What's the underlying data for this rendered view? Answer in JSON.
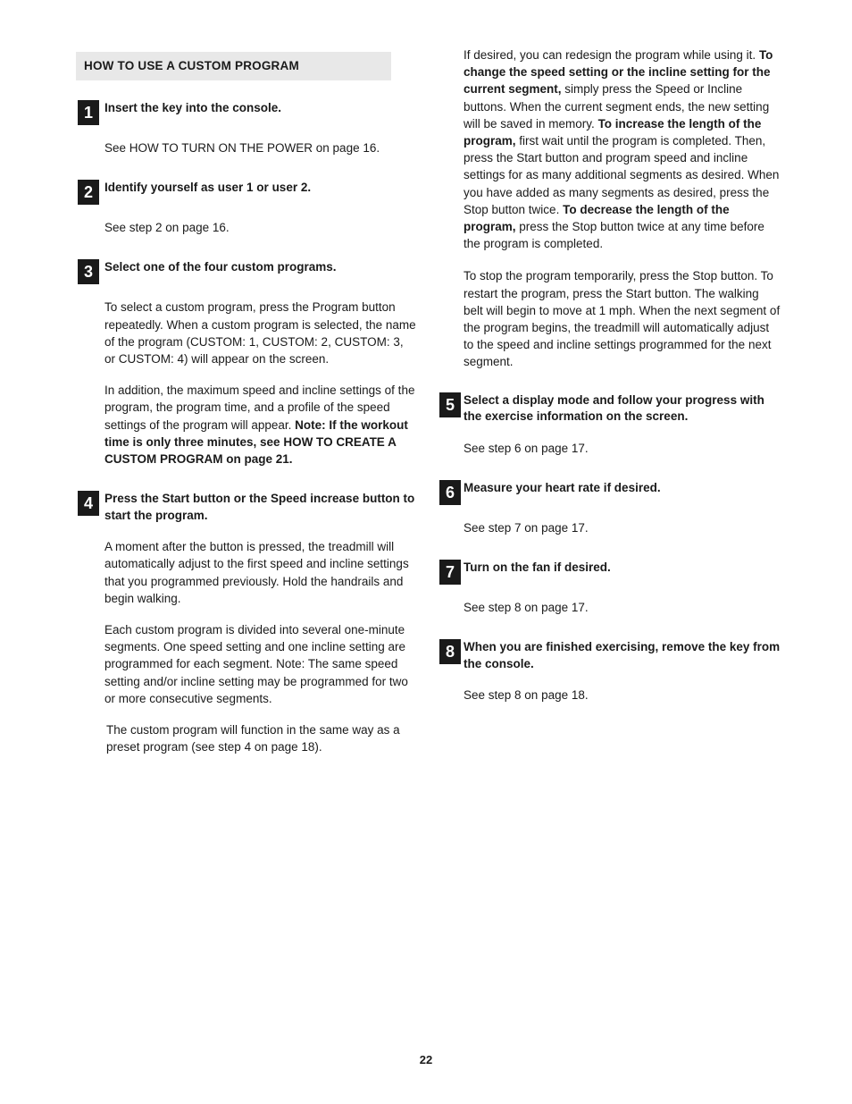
{
  "document": {
    "page_number": "22",
    "banner_title": "HOW TO USE A CUSTOM PROGRAM"
  },
  "left_column": {
    "steps": [
      {
        "number": "1",
        "title": "Insert the key into the console.",
        "body": "See HOW TO TURN ON THE POWER on page 16."
      },
      {
        "number": "2",
        "title": "Identify yourself as user 1 or user 2.",
        "body": "See step 2 on page 16."
      },
      {
        "number": "3",
        "title": "Select one of the four custom programs.",
        "body": "To select a custom program, press the Program button repeatedly. When a custom program is selected, the name of the program (CUSTOM: 1, CUSTOM: 2, CUSTOM: 3, or CUSTOM: 4) will appear on the screen.",
        "body2_plain": "In addition, the maximum speed and incline settings of the program, the program time, and a profile of the speed settings of the program will appear. ",
        "body2_bold": "Note: If the workout time is only three minutes, see HOW TO CREATE A CUSTOM PROGRAM on page 21."
      },
      {
        "number": "4",
        "title": "Press the Start button or the Speed increase button to start the program.",
        "body": "A moment after the button is pressed, the treadmill will automatically adjust to the first speed and incline settings that you programmed previously. Hold the handrails and begin walking.",
        "body2": "Each custom program is divided into several one-minute segments. One speed setting and one incline setting are programmed for each segment. Note: The same speed setting and/or incline setting may be programmed for two or more consecutive segments.",
        "body3": "The custom program will function in the same way as a preset program (see step 4 on page 18)."
      }
    ]
  },
  "right_column": {
    "lead_paragraph": {
      "part1": "If desired, you can redesign the program while using it. ",
      "bold1": "To change the speed setting or the incline setting for the current segment,",
      "part2": " simply press the Speed or Incline buttons. When the current segment ends, the new setting will be saved in memory. ",
      "bold2": "To increase the length of the program,",
      "part3": " first wait until the program is completed. Then, press the Start button and program speed and incline settings for as many additional segments as desired. When you have added as many segments as desired, press the Stop button twice. ",
      "bold3": "To decrease the length of the program,",
      "part4": " press the Stop button twice at any time before the program is completed."
    },
    "second_paragraph": "To stop the program temporarily, press the Stop button. To restart the program, press the Start button. The walking belt will begin to move at 1 mph. When the next segment of the program begins, the treadmill will automatically adjust to the speed and incline settings programmed for the next segment.",
    "steps": [
      {
        "number": "5",
        "title": "Select a display mode and follow your progress with the exercise information on the screen.",
        "body": "See step 6 on page 17."
      },
      {
        "number": "6",
        "title": "Measure your heart rate if desired.",
        "body": "See step 7 on page 17."
      },
      {
        "number": "7",
        "title": "Turn on the fan if desired.",
        "body": "See step 8 on page 17."
      },
      {
        "number": "8",
        "title": "When you are finished exercising, remove the key from the console.",
        "body": "See step 8 on page 18."
      }
    ]
  }
}
